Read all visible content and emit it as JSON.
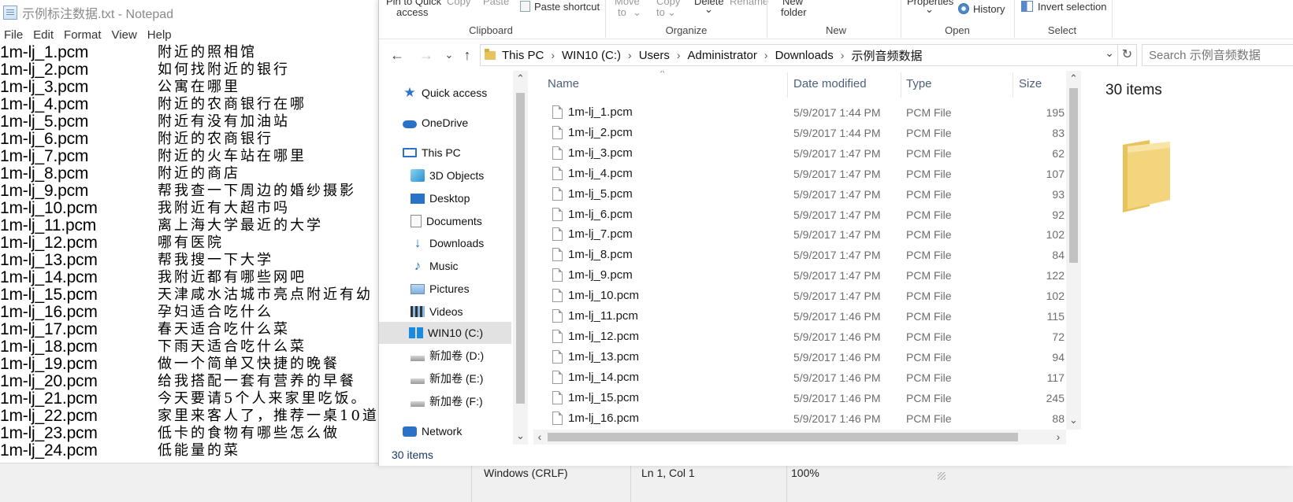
{
  "notepad": {
    "title": "示例标注数据.txt - Notepad",
    "menu": [
      "File",
      "Edit",
      "Format",
      "View",
      "Help"
    ],
    "lines": [
      {
        "file": "1m-lj_1.pcm",
        "text": "附近的照相馆"
      },
      {
        "file": "1m-lj_2.pcm",
        "text": "如何找附近的银行"
      },
      {
        "file": "1m-lj_3.pcm",
        "text": "公寓在哪里"
      },
      {
        "file": "1m-lj_4.pcm",
        "text": "附近的农商银行在哪"
      },
      {
        "file": "1m-lj_5.pcm",
        "text": "附近有没有加油站"
      },
      {
        "file": "1m-lj_6.pcm",
        "text": "附近的农商银行"
      },
      {
        "file": "1m-lj_7.pcm",
        "text": "附近的火车站在哪里"
      },
      {
        "file": "1m-lj_8.pcm",
        "text": "附近的商店"
      },
      {
        "file": "1m-lj_9.pcm",
        "text": "帮我查一下周边的婚纱摄影"
      },
      {
        "file": "1m-lj_10.pcm",
        "text": "我附近有大超市吗"
      },
      {
        "file": "1m-lj_11.pcm",
        "text": "离上海大学最近的大学"
      },
      {
        "file": "1m-lj_12.pcm",
        "text": "哪有医院"
      },
      {
        "file": "1m-lj_13.pcm",
        "text": "帮我搜一下大学"
      },
      {
        "file": "1m-lj_14.pcm",
        "text": "我附近都有哪些网吧"
      },
      {
        "file": "1m-lj_15.pcm",
        "text": "天津咸水沽城市亮点附近有幼"
      },
      {
        "file": "1m-lj_16.pcm",
        "text": "孕妇适合吃什么"
      },
      {
        "file": "1m-lj_17.pcm",
        "text": "春天适合吃什么菜"
      },
      {
        "file": "1m-lj_18.pcm",
        "text": "下雨天适合吃什么菜"
      },
      {
        "file": "1m-lj_19.pcm",
        "text": "做一个简单又快捷的晚餐"
      },
      {
        "file": "1m-lj_20.pcm",
        "text": "给我搭配一套有营养的早餐"
      },
      {
        "file": "1m-lj_21.pcm",
        "text": "今天要请5个人来家里吃饭。"
      },
      {
        "file": "1m-lj_22.pcm",
        "text": "家里来客人了，推荐一桌10道"
      },
      {
        "file": "1m-lj_23.pcm",
        "text": "低卡的食物有哪些怎么做"
      },
      {
        "file": "1m-lj_24.pcm",
        "text": "低能量的菜"
      }
    ],
    "status": {
      "line_ending": "Windows (CRLF)",
      "position": "Ln 1, Col 1",
      "zoom": "100%"
    }
  },
  "explorer": {
    "ribbon": {
      "pin_quick_access": "Pin to Quick",
      "pin_quick_access_2": "access",
      "copy": "Copy",
      "paste": "Paste",
      "paste_shortcut": "Paste shortcut",
      "move_to": "Move",
      "move_to_2": "to",
      "copy_to": "Copy",
      "copy_to_2": "to",
      "delete": "Delete",
      "rename": "Rename",
      "new_folder": "New",
      "new_folder_2": "folder",
      "properties": "Properties",
      "history": "History",
      "invert_selection": "Invert selection",
      "groups": {
        "clipboard": "Clipboard",
        "organize": "Organize",
        "new": "New",
        "open": "Open",
        "select": "Select"
      }
    },
    "address": {
      "crumbs": [
        "This PC",
        "WIN10 (C:)",
        "Users",
        "Administrator",
        "Downloads",
        "示例音频数据"
      ],
      "search_placeholder": "Search 示例音频数据"
    },
    "nav": [
      {
        "label": "Quick access",
        "icon": "star-icon"
      },
      {
        "label": "OneDrive",
        "icon": "cloud-icon"
      },
      {
        "label": "This PC",
        "icon": "computer-icon"
      },
      {
        "label": "3D Objects",
        "icon": "cube-icon"
      },
      {
        "label": "Desktop",
        "icon": "desktop-icon"
      },
      {
        "label": "Documents",
        "icon": "documents-icon"
      },
      {
        "label": "Downloads",
        "icon": "download-icon"
      },
      {
        "label": "Music",
        "icon": "music-icon"
      },
      {
        "label": "Pictures",
        "icon": "pictures-icon"
      },
      {
        "label": "Videos",
        "icon": "videos-icon"
      },
      {
        "label": "WIN10 (C:)",
        "icon": "windows-drive-icon",
        "selected": true
      },
      {
        "label": "新加卷 (D:)",
        "icon": "drive-icon"
      },
      {
        "label": "新加卷 (E:)",
        "icon": "drive-icon"
      },
      {
        "label": "新加卷 (F:)",
        "icon": "drive-icon"
      },
      {
        "label": "Network",
        "icon": "network-icon"
      }
    ],
    "columns": {
      "name": "Name",
      "date": "Date modified",
      "type": "Type",
      "size": "Size"
    },
    "files": [
      {
        "name": "1m-lj_1.pcm",
        "date": "5/9/2017 1:44 PM",
        "type": "PCM File",
        "size": "195"
      },
      {
        "name": "1m-lj_2.pcm",
        "date": "5/9/2017 1:44 PM",
        "type": "PCM File",
        "size": "83"
      },
      {
        "name": "1m-lj_3.pcm",
        "date": "5/9/2017 1:47 PM",
        "type": "PCM File",
        "size": "62"
      },
      {
        "name": "1m-lj_4.pcm",
        "date": "5/9/2017 1:47 PM",
        "type": "PCM File",
        "size": "107"
      },
      {
        "name": "1m-lj_5.pcm",
        "date": "5/9/2017 1:47 PM",
        "type": "PCM File",
        "size": "93"
      },
      {
        "name": "1m-lj_6.pcm",
        "date": "5/9/2017 1:47 PM",
        "type": "PCM File",
        "size": "92"
      },
      {
        "name": "1m-lj_7.pcm",
        "date": "5/9/2017 1:47 PM",
        "type": "PCM File",
        "size": "102"
      },
      {
        "name": "1m-lj_8.pcm",
        "date": "5/9/2017 1:47 PM",
        "type": "PCM File",
        "size": "84"
      },
      {
        "name": "1m-lj_9.pcm",
        "date": "5/9/2017 1:47 PM",
        "type": "PCM File",
        "size": "122"
      },
      {
        "name": "1m-lj_10.pcm",
        "date": "5/9/2017 1:47 PM",
        "type": "PCM File",
        "size": "102"
      },
      {
        "name": "1m-lj_11.pcm",
        "date": "5/9/2017 1:46 PM",
        "type": "PCM File",
        "size": "115"
      },
      {
        "name": "1m-lj_12.pcm",
        "date": "5/9/2017 1:46 PM",
        "type": "PCM File",
        "size": "72"
      },
      {
        "name": "1m-lj_13.pcm",
        "date": "5/9/2017 1:46 PM",
        "type": "PCM File",
        "size": "94"
      },
      {
        "name": "1m-lj_14.pcm",
        "date": "5/9/2017 1:46 PM",
        "type": "PCM File",
        "size": "117"
      },
      {
        "name": "1m-lj_15.pcm",
        "date": "5/9/2017 1:46 PM",
        "type": "PCM File",
        "size": "245"
      },
      {
        "name": "1m-lj_16.pcm",
        "date": "5/9/2017 1:46 PM",
        "type": "PCM File",
        "size": "88"
      }
    ],
    "details": {
      "item_count": "30 items"
    },
    "status": {
      "item_count": "30 items"
    },
    "colors": {
      "accent": "#2a72c8",
      "folder": "#f0cf72",
      "selection": "#e2e2e2"
    }
  }
}
